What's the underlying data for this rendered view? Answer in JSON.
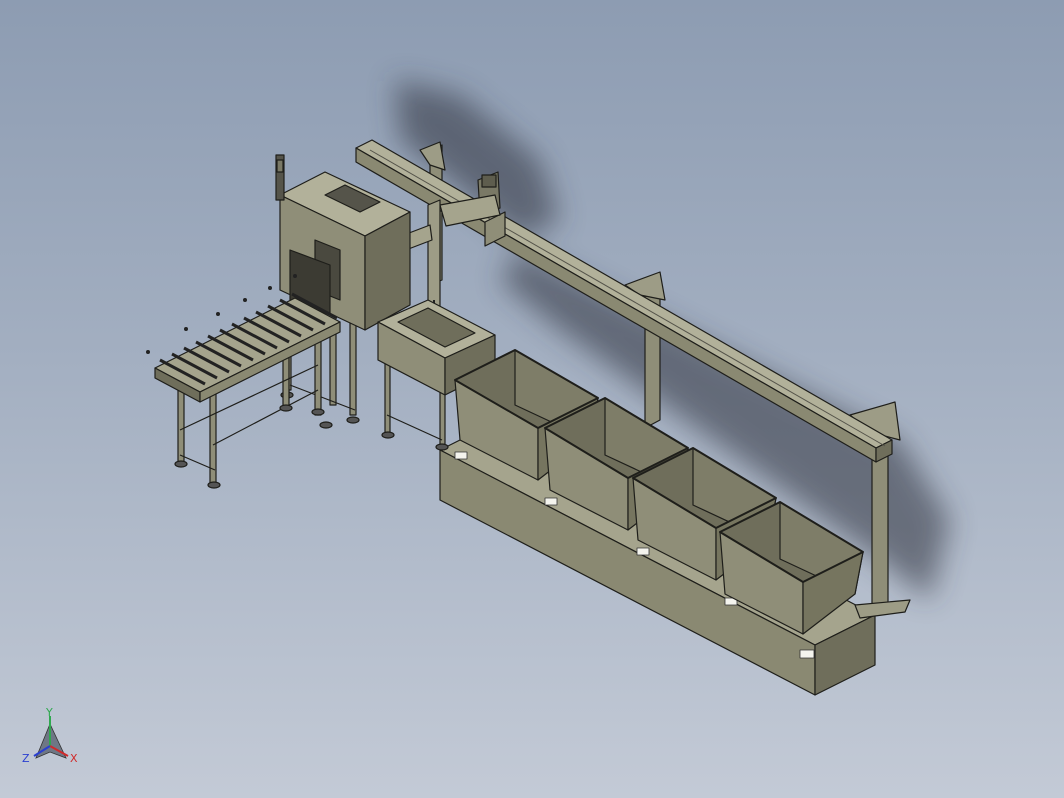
{
  "viewport": {
    "background_top": "#8d9cb2",
    "background_bottom": "#c3cad6"
  },
  "model": {
    "components": [
      "roller-conveyor",
      "inspection-cabinet",
      "small-buffer-tank",
      "gantry-rail",
      "gantry-carriage",
      "vertical-lift-mast",
      "tank-1",
      "tank-2",
      "tank-3",
      "tank-4",
      "tank-base-platform"
    ],
    "body_color": "#8f8e78",
    "edge_color": "#1e1e1a"
  },
  "triad": {
    "y_label": "Y",
    "x_label": "X",
    "z_label": "Z",
    "y_color": "#2fa84f",
    "x_color": "#d02a2a",
    "z_color": "#2a3fd0"
  }
}
